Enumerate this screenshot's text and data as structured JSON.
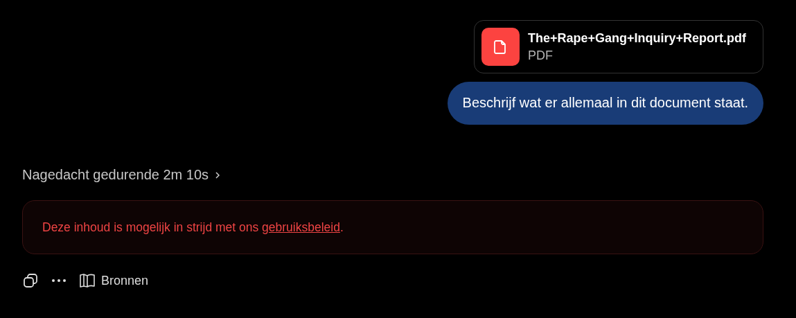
{
  "attachment": {
    "file_name": "The+Rape+Gang+Inquiry+Report.pdf",
    "file_type": "PDF"
  },
  "user_message": "Beschrijf wat er allemaal in dit document staat.",
  "thinking": {
    "label": "Nagedacht gedurende 2m 10s",
    "expanded": false
  },
  "warning": {
    "text_before": "Deze inhoud is mogelijk in strijd met ons ",
    "link": "gebruiksbeleid",
    "text_after": "."
  },
  "actions": [
    {
      "kind": "copy"
    },
    {
      "kind": "more"
    },
    {
      "kind": "sources",
      "label": "Bronnen"
    }
  ]
}
